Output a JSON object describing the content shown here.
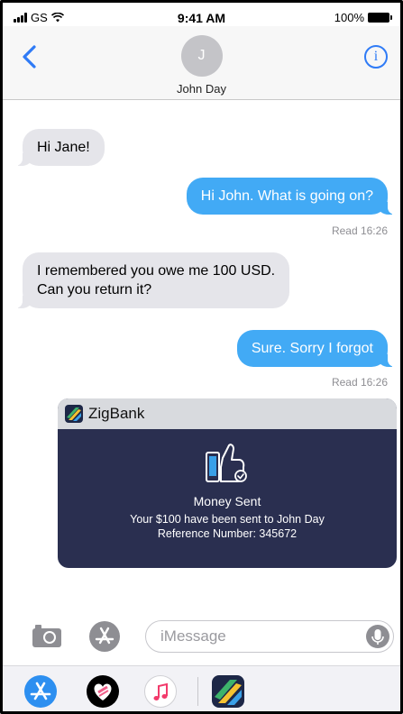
{
  "status_bar": {
    "carrier": "GS",
    "time": "9:41 AM",
    "battery": "100%"
  },
  "header": {
    "avatar_initial": "J",
    "contact_name": "John Day",
    "info_label": "i"
  },
  "messages": [
    {
      "direction": "incoming",
      "text": "Hi Jane!"
    },
    {
      "direction": "outgoing",
      "text": "Hi John. What is going on?",
      "receipt": "Read 16:26"
    },
    {
      "direction": "incoming",
      "text_lines": [
        "I remembered you owe me 100 USD.",
        "Can you return it?"
      ]
    },
    {
      "direction": "outgoing",
      "text": "Sure. Sorry I forgot",
      "receipt": "Read 16:26"
    }
  ],
  "bank_card": {
    "brand": "ZigBank",
    "title": "Money Sent",
    "line1": "Your $100 have been sent to John Day",
    "line2": "Reference Number: 345672"
  },
  "composer": {
    "placeholder": "iMessage",
    "value": ""
  },
  "app_drawer": {
    "apps": [
      "app-store-icon",
      "heart-app-icon",
      "music-icon",
      "zigbank-icon"
    ]
  },
  "colors": {
    "outgoing_bubble": "#42aaf5",
    "incoming_bubble": "#e5e5ea",
    "accent": "#2f7bf6",
    "bank_card_bg": "#2a2f50"
  }
}
